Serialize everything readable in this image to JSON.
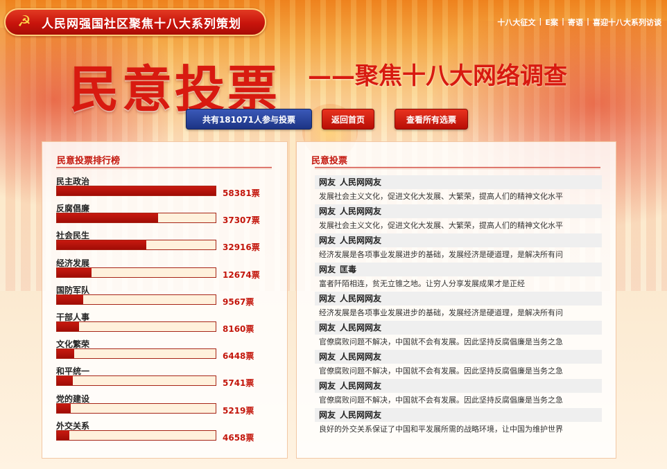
{
  "header": {
    "pill_title": "人民网强国社区聚焦十八大系列策划",
    "links": [
      "十八大征文",
      "E案",
      "寄语",
      "喜迎十八大系列访谈"
    ]
  },
  "banner": {
    "title": "民意投票",
    "subtitle": "——聚焦十八大网络调查"
  },
  "buttons": {
    "count_label": "共有181071人参与投票",
    "home_label": "返回首页",
    "all_label": "查看所有选票"
  },
  "ranking": {
    "title": "民意投票排行榜",
    "items": [
      {
        "label": "民主政治",
        "count": "58381票",
        "value": 58381
      },
      {
        "label": "反腐倡廉",
        "count": "37307票",
        "value": 37307
      },
      {
        "label": "社会民生",
        "count": "32916票",
        "value": 32916
      },
      {
        "label": "经济发展",
        "count": "12674票",
        "value": 12674
      },
      {
        "label": "国防军队",
        "count": "9567票",
        "value": 9567
      },
      {
        "label": "干部人事",
        "count": "8160票",
        "value": 8160
      },
      {
        "label": "文化繁荣",
        "count": "6448票",
        "value": 6448
      },
      {
        "label": "和平统一",
        "count": "5741票",
        "value": 5741
      },
      {
        "label": "党的建设",
        "count": "5219票",
        "value": 5219
      },
      {
        "label": "外交关系",
        "count": "4658票",
        "value": 4658
      }
    ]
  },
  "votes": {
    "title": "民意投票",
    "items": [
      {
        "prefix": "网友",
        "user": "人民网网友",
        "text": "发展社会主义文化，促进文化大发展、大繁荣，提高人们的精神文化水平"
      },
      {
        "prefix": "网友",
        "user": "人民网网友",
        "text": "发展社会主义文化，促进文化大发展、大繁荣，提高人们的精神文化水平"
      },
      {
        "prefix": "网友",
        "user": "人民网网友",
        "text": "经济发展是各项事业发展进步的基础，发展经济是硬道理，是解决所有问"
      },
      {
        "prefix": "网友",
        "user": "匡毒",
        "text": "富者阡陌相连，贫无立锥之地。让穷人分享发展成果才是正经"
      },
      {
        "prefix": "网友",
        "user": "人民网网友",
        "text": "经济发展是各项事业发展进步的基础，发展经济是硬道理，是解决所有问"
      },
      {
        "prefix": "网友",
        "user": "人民网网友",
        "text": "官僚腐败问题不解决，中国就不会有发展。因此坚持反腐倡廉是当务之急"
      },
      {
        "prefix": "网友",
        "user": "人民网网友",
        "text": "官僚腐败问题不解决，中国就不会有发展。因此坚持反腐倡廉是当务之急"
      },
      {
        "prefix": "网友",
        "user": "人民网网友",
        "text": "官僚腐败问题不解决，中国就不会有发展。因此坚持反腐倡廉是当务之急"
      },
      {
        "prefix": "网友",
        "user": "人民网网友",
        "text": "良好的外交关系保证了中国和平发展所需的战略环境，让中国为维护世界"
      }
    ]
  },
  "colors": {
    "accent_red": "#c3160c",
    "button_blue": "#1c3484",
    "bar_red": "#a00c06"
  }
}
